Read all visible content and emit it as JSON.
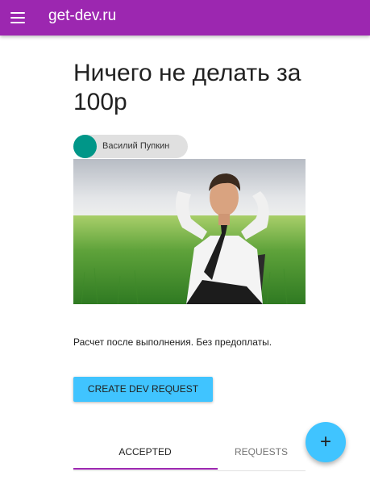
{
  "app": {
    "title": "get-dev.ru",
    "menu_icon": "menu-icon",
    "primary_color": "#9c27b0",
    "accent_color": "#40c4ff"
  },
  "offer": {
    "title": "Ничего не делать за 100р",
    "author": {
      "name": "Василий Пупкин",
      "avatar_color": "#009688"
    },
    "description": "Расчет после выполнения. Без предоплаты."
  },
  "actions": {
    "create_request_label": "CREATE DEV REQUEST"
  },
  "tabs": [
    {
      "label": "ACCEPTED",
      "active": true
    },
    {
      "label": "REQUESTS",
      "active": false
    }
  ],
  "fab": {
    "icon": "plus-icon",
    "symbol": "+"
  }
}
